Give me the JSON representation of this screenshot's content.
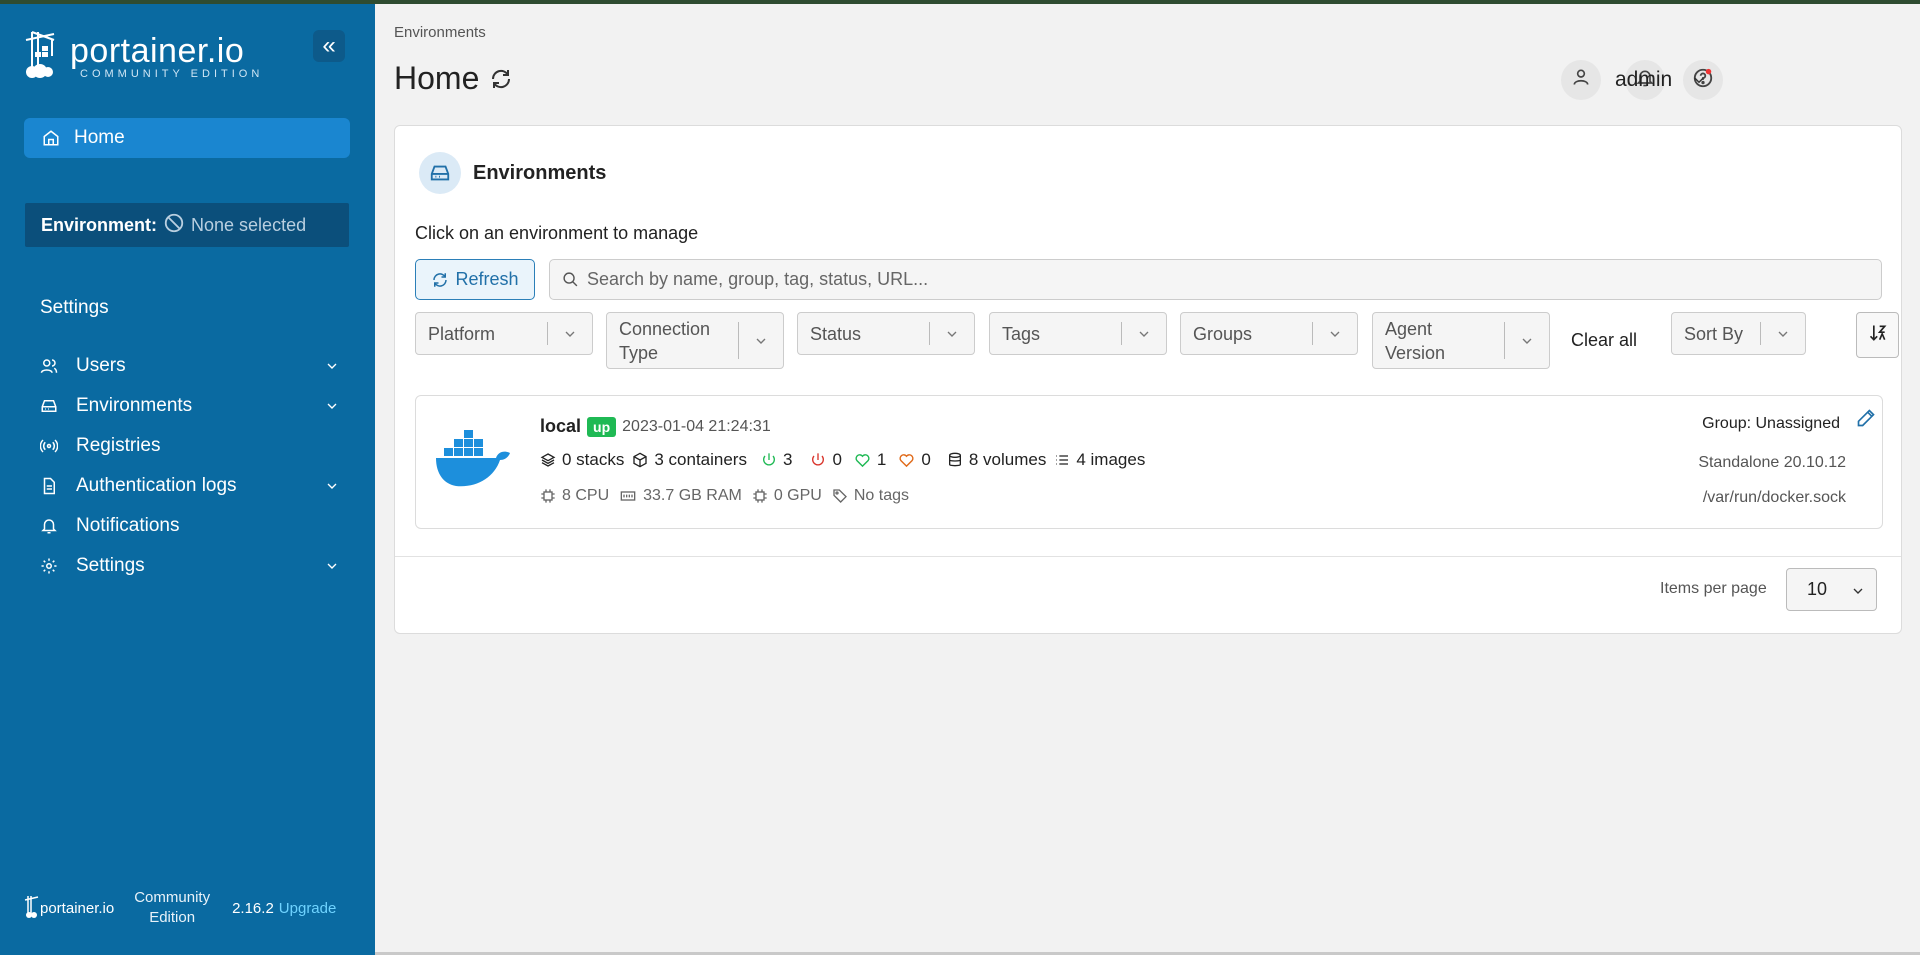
{
  "colors": {
    "sidebar": "#0a6aa1",
    "home_active": "#1a86d0",
    "status_up": "#1fb954",
    "link": "#2170a8"
  },
  "sidebar": {
    "logo_word": "portainer.io",
    "logo_sub": "COMMUNITY EDITION",
    "collapse_icon": "«",
    "home_label": "Home",
    "environment_label": "Environment:",
    "environment_value": "None selected",
    "settings_title": "Settings",
    "items": [
      {
        "label": "Users",
        "icon": "users-icon",
        "expandable": true
      },
      {
        "label": "Environments",
        "icon": "environments-icon",
        "expandable": true
      },
      {
        "label": "Registries",
        "icon": "registries-icon",
        "expandable": false
      },
      {
        "label": "Authentication logs",
        "icon": "auth-logs-icon",
        "expandable": true
      },
      {
        "label": "Notifications",
        "icon": "bell-icon",
        "expandable": false
      },
      {
        "label": "Settings",
        "icon": "gear-icon",
        "expandable": true
      }
    ],
    "footer": {
      "brand": "portainer.io",
      "edition_line1": "Community",
      "edition_line2": "Edition",
      "version": "2.16.2",
      "upgrade": "Upgrade"
    }
  },
  "header": {
    "breadcrumb": "Environments",
    "title": "Home",
    "user": "admin"
  },
  "card": {
    "title": "Environments",
    "hint": "Click on an environment to manage",
    "refresh_label": "Refresh",
    "search_placeholder": "Search by name, group, tag, status, URL...",
    "filters": {
      "platform": "Platform",
      "connection_type": "Connection\nType",
      "status": "Status",
      "tags": "Tags",
      "groups": "Groups",
      "agent_version": "Agent\nVersion"
    },
    "clear_all": "Clear all",
    "sort_by": "Sort By",
    "environment": {
      "name": "local",
      "status": "up",
      "timestamp": "2023-01-04 21:24:31",
      "stacks": "0 stacks",
      "containers": "3 containers",
      "running": "3",
      "stopped": "0",
      "healthy": "1",
      "unhealthy": "0",
      "volumes": "8 volumes",
      "images": "4 images",
      "cpu": "8 CPU",
      "ram": "33.7 GB RAM",
      "gpu": "0 GPU",
      "tags": "No tags",
      "group": "Group: Unassigned",
      "type": "Standalone 20.10.12",
      "url": "/var/run/docker.sock"
    },
    "items_per_page_label": "Items per page",
    "items_per_page_value": "10"
  }
}
